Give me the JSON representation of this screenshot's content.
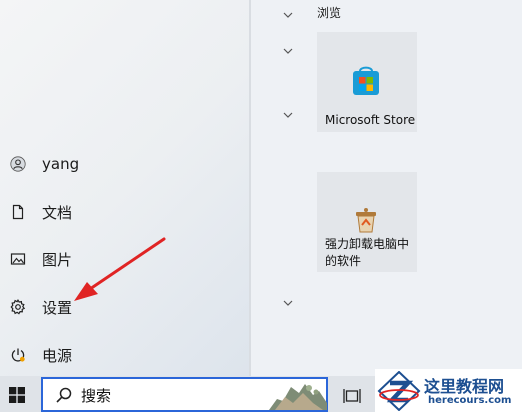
{
  "start_menu": {
    "user": {
      "name": "yang"
    },
    "nav": {
      "documents": "文档",
      "pictures": "图片",
      "settings": "设置",
      "power": "电源"
    },
    "groups": [
      {
        "title": "浏览"
      }
    ],
    "tiles": {
      "store": {
        "label": "Microsoft Store"
      },
      "uninstaller": {
        "label_line1": "强力卸载电脑中",
        "label_line2": "的软件"
      }
    }
  },
  "taskbar": {
    "search": {
      "value": "搜索"
    }
  },
  "watermark": {
    "title": "这里教程网",
    "url": "herecours.com"
  },
  "colors": {
    "arrow_red": "#e02424",
    "search_border": "#2b66d9",
    "power_accent": "#f0a000"
  }
}
